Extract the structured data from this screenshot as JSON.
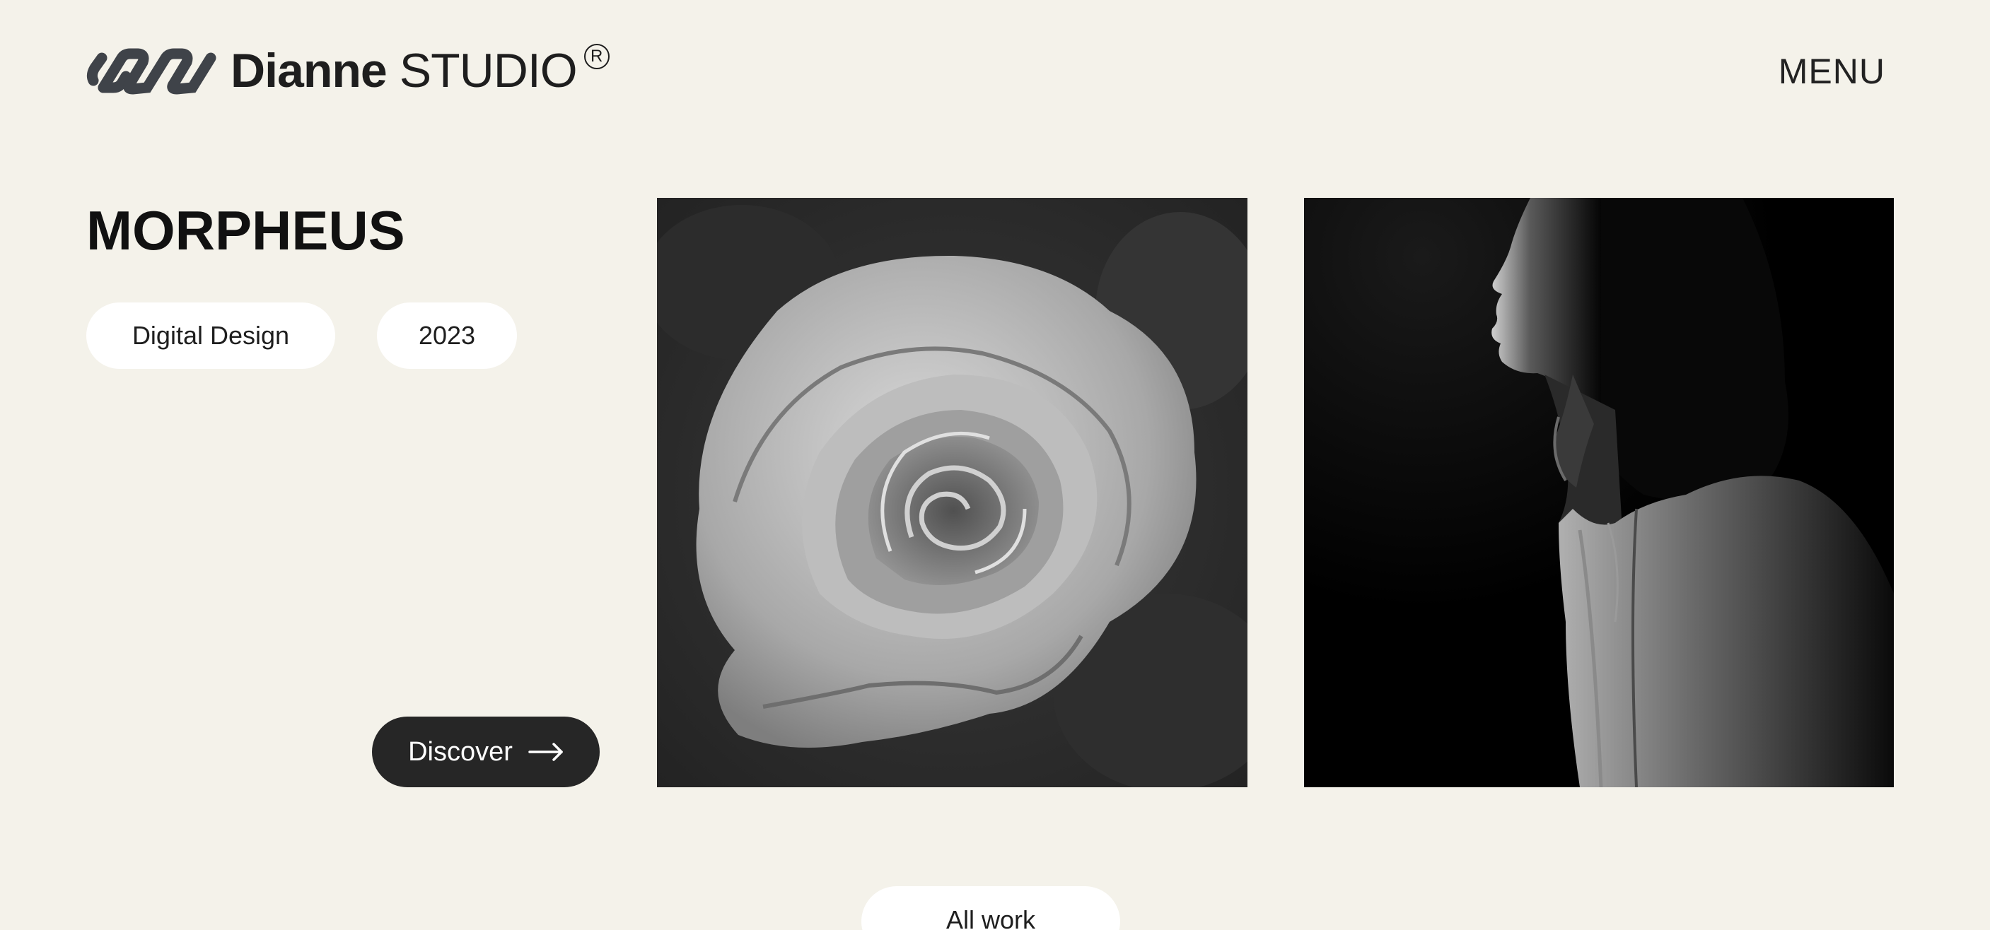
{
  "brand": {
    "name_bold": "Dianne",
    "name_light": "STUDIO",
    "registered": "R",
    "logo_icon": "chain-links-icon",
    "color": "#3f4349"
  },
  "nav": {
    "menu_label": "MENU"
  },
  "project": {
    "title": "MORPHEUS",
    "category": "Digital Design",
    "year": "2023",
    "discover_label": "Discover",
    "discover_icon": "arrow-right-icon"
  },
  "gallery": [
    {
      "name": "rose-image",
      "subject": "rose-photo"
    },
    {
      "name": "woman-image",
      "subject": "woman-silhouette-photo"
    }
  ],
  "footer": {
    "all_work_label": "All work"
  },
  "colors": {
    "background": "#f4f2ea",
    "pill": "#ffffff",
    "button_dark": "#262626",
    "text": "#1c1c1c"
  }
}
